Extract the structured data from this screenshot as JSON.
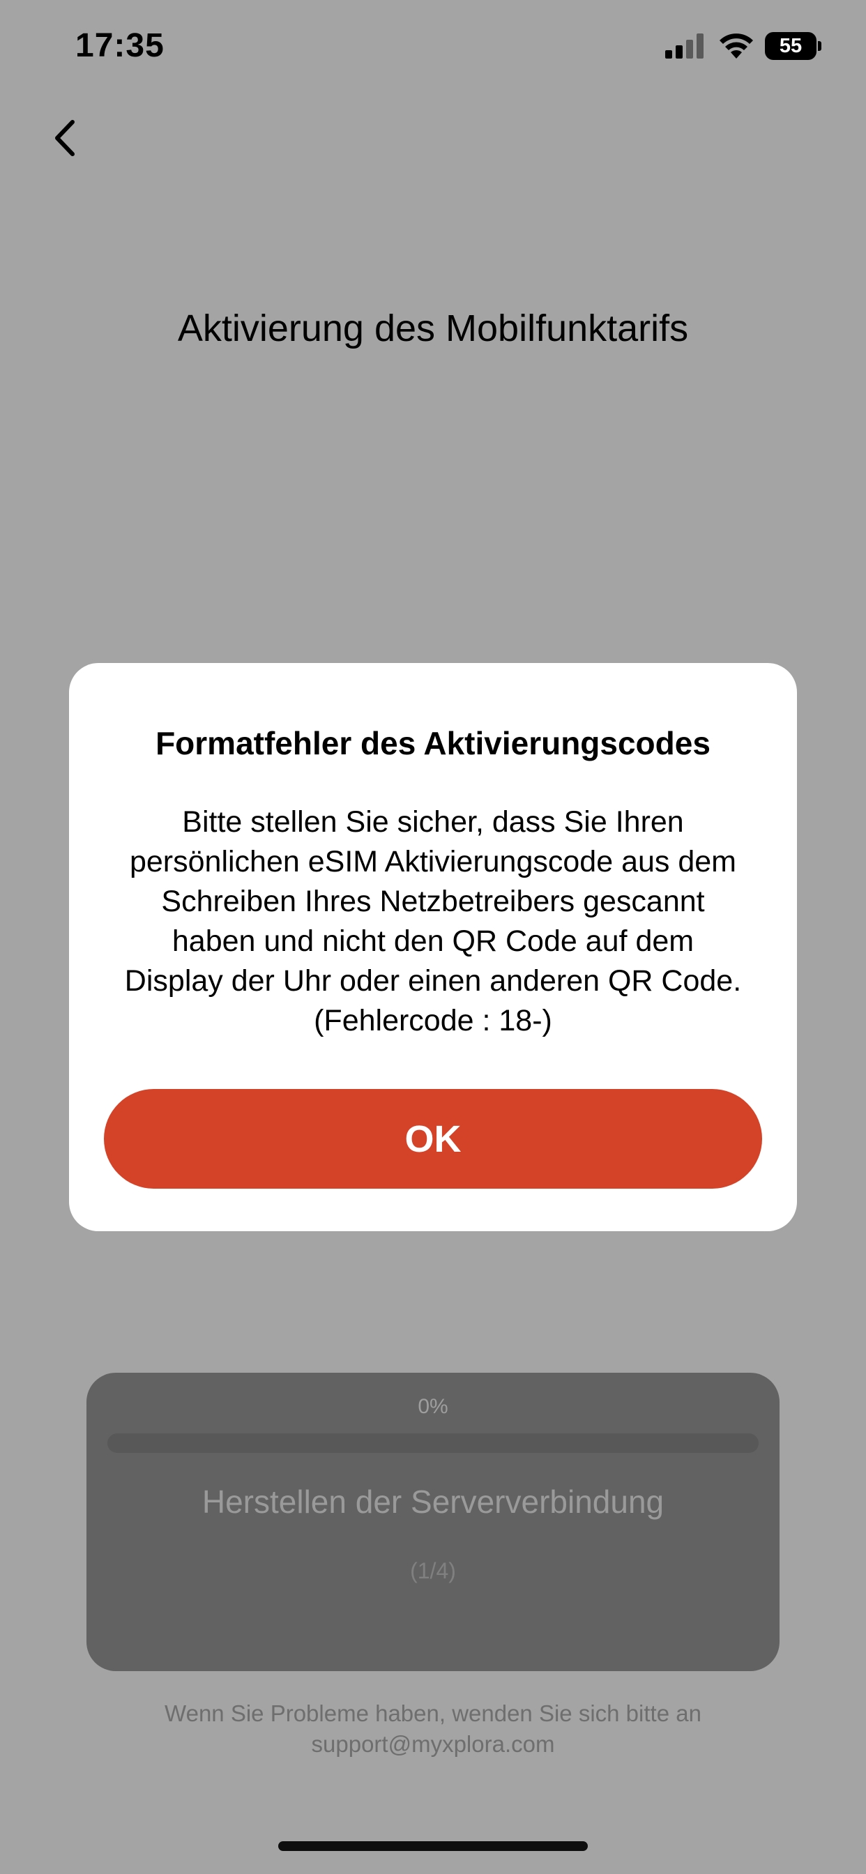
{
  "status_bar": {
    "time": "17:35",
    "battery_percent": "55",
    "icons": [
      "cellular-signal-icon",
      "wifi-icon",
      "battery-icon"
    ]
  },
  "nav": {
    "back_icon": "chevron-left-icon"
  },
  "page": {
    "title": "Aktivierung des Mobilfunktarifs"
  },
  "progress": {
    "percent_label": "0%",
    "percent_value": 0,
    "step_label": "Herstellen der Serververbindung",
    "step_count": "(1/4)"
  },
  "support": {
    "line1": "Wenn Sie Probleme haben, wenden Sie sich bitte an",
    "line2": "support@myxplora.com"
  },
  "dialog": {
    "title": "Formatfehler des Aktivierungscodes",
    "message": "Bitte stellen Sie sicher, dass Sie Ihren\npersönlichen eSIM Aktivierungscode aus dem\nSchreiben Ihres Netzbetreibers gescannt\nhaben und nicht den QR Code auf dem\nDisplay der Uhr oder einen anderen QR Code.\n(Fehlercode : 18-)",
    "ok_label": "OK"
  },
  "colors": {
    "overlay_background": "#a4a4a4",
    "accent": "#d44228",
    "dialog_background": "#ffffff"
  }
}
